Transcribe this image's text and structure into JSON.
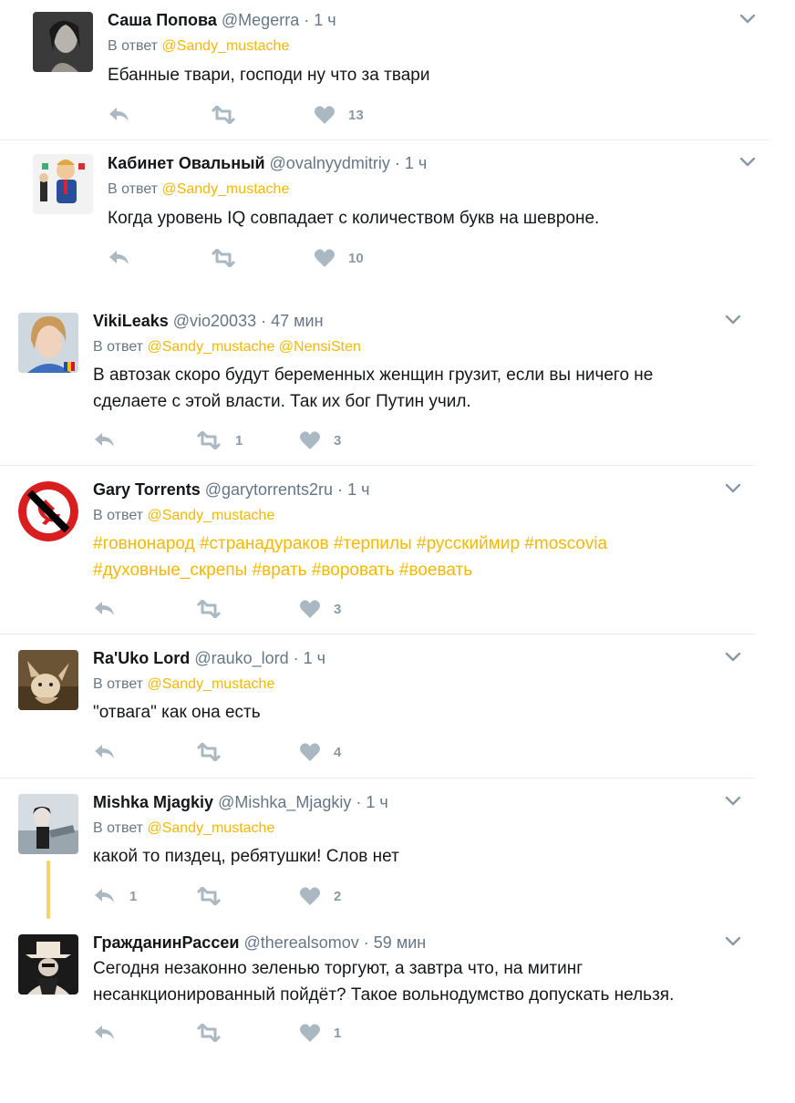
{
  "reply_prefix": "В ответ",
  "tweets": [
    {
      "name": "Саша Попова",
      "handle": "@Megerra",
      "dot": "·",
      "time": "1 ч",
      "reply_to": [
        "@Sandy_mustache"
      ],
      "text": "Ебанные твари, господи ну что за твари",
      "replies": "",
      "retweets": "",
      "likes": "13"
    },
    {
      "name": "Кабинет Овальный",
      "handle": "@ovalnyydmitriy",
      "dot": "·",
      "time": "1 ч",
      "reply_to": [
        "@Sandy_mustache"
      ],
      "text": "Когда уровень IQ совпадает с количеством букв на шевроне.",
      "replies": "",
      "retweets": "",
      "likes": "10"
    },
    {
      "name": "VikiLeaks",
      "handle": "@vio20033",
      "dot": "·",
      "time": "47 мин",
      "reply_to": [
        "@Sandy_mustache",
        "@NensiSten"
      ],
      "text_lines": [
        "В автозак скоро будут беременных женщин грузит, если вы ничего не",
        "сделаете с этой власти. Так их бог Путин учил."
      ],
      "replies": "",
      "retweets": "1",
      "likes": "3"
    },
    {
      "name": "Gary Torrents",
      "handle": "@garytorrents2ru",
      "dot": "·",
      "time": "1 ч",
      "reply_to": [
        "@Sandy_mustache"
      ],
      "hashtags_line1": [
        "#говнонарод",
        "#странадураков",
        "#терпилы",
        "#русскиймир",
        "#moscovia"
      ],
      "hashtags_line2": [
        "#духовные_скрепы",
        "#врать",
        "#воровать",
        "#воевать"
      ],
      "replies": "",
      "retweets": "",
      "likes": "3"
    },
    {
      "name": "Ra'Uko Lord",
      "handle": "@rauko_lord",
      "dot": "·",
      "time": "1 ч",
      "reply_to": [
        "@Sandy_mustache"
      ],
      "text": "\"отвага\" как она есть",
      "replies": "",
      "retweets": "",
      "likes": "4"
    },
    {
      "name": "Mishka Mjagkiy",
      "handle": "@Mishka_Mjagkiy",
      "dot": "·",
      "time": "1 ч",
      "reply_to": [
        "@Sandy_mustache"
      ],
      "text": "какой то пиздец, ребятушки! Слов нет",
      "replies": "1",
      "retweets": "",
      "likes": "2"
    },
    {
      "name": "ГражданинРассеи",
      "handle": "@therealsomov",
      "dot": "·",
      "time": "59 мин",
      "text_lines": [
        "Сегодня незаконно зеленью торгуют, а завтра что, на митинг",
        "несанкционированный пойдёт? Такое вольнодумство допускать нельзя."
      ],
      "replies": "",
      "retweets": "",
      "likes": "1"
    }
  ],
  "icons": {
    "reply": "reply-icon",
    "retweet": "retweet-icon",
    "like": "heart-icon",
    "more": "chevron-down-icon"
  },
  "colors": {
    "accent": "#f5b800",
    "muted": "#657786",
    "icon": "#aab8c2",
    "divider": "#e6ecf0",
    "thread": "#f5d36a"
  }
}
